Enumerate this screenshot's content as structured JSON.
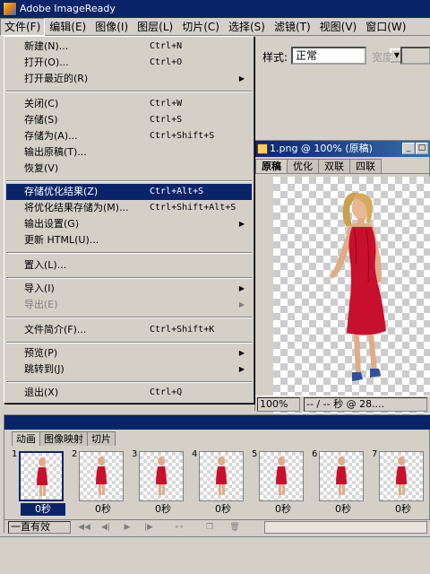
{
  "app": {
    "title": "Adobe ImageReady"
  },
  "menubar": {
    "items": [
      "文件(F)",
      "编辑(E)",
      "图像(I)",
      "图层(L)",
      "切片(C)",
      "选择(S)",
      "滤镜(T)",
      "视图(V)",
      "窗口(W)"
    ]
  },
  "file_menu": {
    "items": [
      {
        "label": "新建(N)...",
        "shortcut": "Ctrl+N"
      },
      {
        "label": "打开(O)...",
        "shortcut": "Ctrl+O"
      },
      {
        "label": "打开最近的(R)",
        "submenu": true
      },
      {
        "label": "关闭(C)",
        "shortcut": "Ctrl+W"
      },
      {
        "label": "存储(S)",
        "shortcut": "Ctrl+S"
      },
      {
        "label": "存储为(A)...",
        "shortcut": "Ctrl+Shift+S"
      },
      {
        "label": "输出原稿(T)..."
      },
      {
        "label": "恢复(V)"
      },
      {
        "label": "存储优化结果(Z)",
        "shortcut": "Ctrl+Alt+S",
        "highlighted": true
      },
      {
        "label": "将优化结果存储为(M)...",
        "shortcut": "Ctrl+Shift+Alt+S"
      },
      {
        "label": "输出设置(G)",
        "submenu": true
      },
      {
        "label": "更新 HTML(U)..."
      },
      {
        "label": "置入(L)..."
      },
      {
        "label": "导入(I)",
        "submenu": true
      },
      {
        "label": "导出(E)",
        "submenu": true,
        "disabled": true
      },
      {
        "label": "文件简介(F)...",
        "shortcut": "Ctrl+Shift+K"
      },
      {
        "label": "预览(P)",
        "submenu": true
      },
      {
        "label": "跳转到(J)",
        "submenu": true
      },
      {
        "label": "退出(X)",
        "shortcut": "Ctrl+Q"
      }
    ]
  },
  "options_bar": {
    "style_label": "样式:",
    "style_value": "正常",
    "width_label": "宽度"
  },
  "document": {
    "title": "1.png @ 100% (原稿)",
    "tabs": [
      "原稿",
      "优化",
      "双联",
      "四联"
    ],
    "zoom": "100%",
    "status": "-- / -- 秒 @ 28...."
  },
  "animation_panel": {
    "tabs": [
      "动画",
      "图像映射",
      "切片"
    ],
    "frames": [
      {
        "number": "1",
        "delay": "0秒"
      },
      {
        "number": "2",
        "delay": "0秒"
      },
      {
        "number": "3",
        "delay": "0秒"
      },
      {
        "number": "4",
        "delay": "0秒"
      },
      {
        "number": "5",
        "delay": "0秒"
      },
      {
        "number": "6",
        "delay": "0秒"
      },
      {
        "number": "7",
        "delay": "0秒"
      }
    ],
    "loop": "一直有效"
  },
  "colors": {
    "title_bar": "#0a246a",
    "dress": "#c8102e",
    "highlight": "#0a246a",
    "face": "#d4d0c8"
  }
}
